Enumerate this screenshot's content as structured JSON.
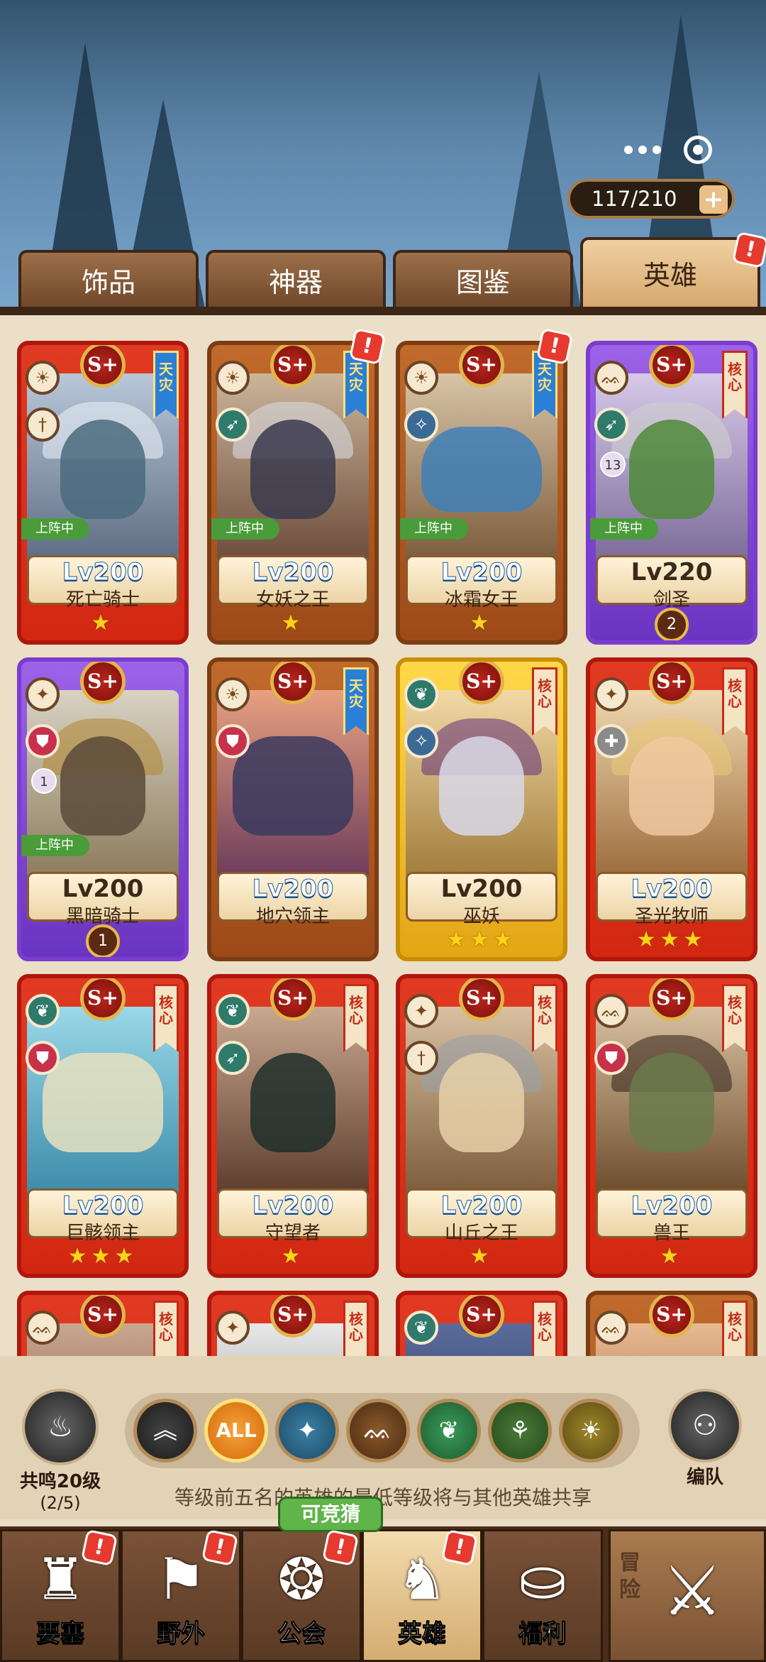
{
  "status": {
    "count": "117/210",
    "plus": "+"
  },
  "tabs": [
    {
      "label": "饰品"
    },
    {
      "label": "神器"
    },
    {
      "label": "图鉴"
    },
    {
      "label": "英雄"
    }
  ],
  "badge_mark": "!",
  "rank_label": "S+",
  "deploy_label": "上阵中",
  "ribbons": {
    "tianzai": "天灾",
    "core": "核心"
  },
  "heroes": [
    {
      "level": "Lv200",
      "name": "死亡骑士",
      "stars": "★"
    },
    {
      "level": "Lv200",
      "name": "女妖之王",
      "stars": "★"
    },
    {
      "level": "Lv200",
      "name": "冰霜女王",
      "stars": "★"
    },
    {
      "level": "Lv220",
      "name": "剑圣",
      "stars": "",
      "medal": "2",
      "icon_number": "13"
    },
    {
      "level": "Lv200",
      "name": "黑暗骑士",
      "stars": "",
      "medal": "1",
      "icon_number": "1"
    },
    {
      "level": "Lv200",
      "name": "地穴领主",
      "stars": ""
    },
    {
      "level": "Lv200",
      "name": "巫妖",
      "stars": "★★★"
    },
    {
      "level": "Lv200",
      "name": "圣光牧师",
      "stars": "★★★"
    },
    {
      "level": "Lv200",
      "name": "巨骸领主",
      "stars": "★★★"
    },
    {
      "level": "Lv200",
      "name": "守望者",
      "stars": "★"
    },
    {
      "level": "Lv200",
      "name": "山丘之王",
      "stars": "★"
    },
    {
      "level": "Lv200",
      "name": "兽王",
      "stars": "★"
    }
  ],
  "resonance": {
    "line1": "共鸣20级",
    "line2": "(2/5)"
  },
  "filters": {
    "all": "ALL"
  },
  "team_label": "编队",
  "hint": "等级前五名的英雄的最低等级将与其他英雄共享",
  "guess_label": "可竞猜",
  "nav": [
    {
      "label": "要塞"
    },
    {
      "label": "野外"
    },
    {
      "label": "公会"
    },
    {
      "label": "英雄"
    },
    {
      "label": "福利"
    }
  ],
  "adventure_label": "冒险",
  "colors": {
    "accent": "#d22812",
    "gold": "#ffd21a",
    "deploy": "#4a9b3a"
  }
}
